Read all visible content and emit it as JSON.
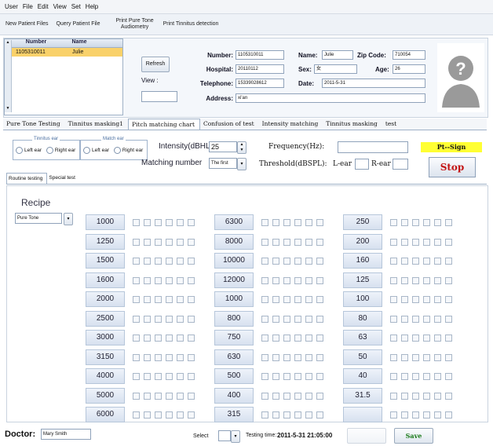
{
  "menu": [
    "User",
    "File",
    "Edit",
    "View",
    "Set",
    "Help"
  ],
  "toolbar": {
    "new_patient": "New Patient Files",
    "query_patient": "Query Patient File",
    "print_pure_tone_1": "Print Pure Tone",
    "print_pure_tone_2": "Audiometry",
    "print_tinnitus": "Print Tinnitus detection"
  },
  "patient_table": {
    "headers": [
      "Number",
      "Name"
    ],
    "rows": [
      {
        "number": "1105310011",
        "name": "Julie"
      }
    ]
  },
  "patient": {
    "refresh": "Refresh",
    "view_label": "View :",
    "number_label": "Number:",
    "number": "1105310011",
    "name_label": "Name:",
    "name": "Julie",
    "zip_label": "Zip Code:",
    "zip": "710054",
    "hospital_label": "Hospital:",
    "hospital": "20110112",
    "sex_label": "Sex:",
    "sex": "女",
    "age_label": "Age:",
    "age": "26",
    "telephone_label": "Telephone:",
    "telephone": "15339028612",
    "date_label": "Date:",
    "date": "2011-5-31",
    "address_label": "Address:",
    "address": "xi'an"
  },
  "tabs": [
    "Pure Tone Testing",
    "Tinnitus masking1",
    "Pitch matching chart",
    "Confusion of test",
    "Intensity matching",
    "Tinnitus masking",
    "test"
  ],
  "controls": {
    "tinnitus_ear_title": "Tinnitus ear",
    "match_ear_title": "Match ear",
    "left_ear": "Left ear",
    "right_ear": "Right ear",
    "intensity_label": "Intensity(dBHL)",
    "intensity_value": "25",
    "matching_label": "Matching number",
    "matching_value": "The first",
    "frequency_label": "Frequency(Hz):",
    "threshold_label": "Threshold(dBSPL):",
    "lear_label": "L-ear",
    "rear_label": "R-ear",
    "pt_sign": "Pt--Sign",
    "stop": "Stop"
  },
  "subtabs": [
    "Routine testing",
    "Special test"
  ],
  "recipe": {
    "label": "Recipe",
    "value": "Pure Tone"
  },
  "frequencies": {
    "col1": [
      "1000",
      "1250",
      "1500",
      "1600",
      "2000",
      "2500",
      "3000",
      "3150",
      "4000",
      "5000",
      "6000"
    ],
    "col2": [
      "6300",
      "8000",
      "10000",
      "12000",
      "1000",
      "800",
      "750",
      "630",
      "500",
      "400",
      "315"
    ],
    "col3": [
      "250",
      "200",
      "160",
      "125",
      "100",
      "80",
      "63",
      "50",
      "40",
      "31.5",
      ""
    ]
  },
  "footer": {
    "doctor_label": "Doctor:",
    "doctor": "Mary Smith",
    "select_label": "Select",
    "testing_time_label": "Testing time:",
    "testing_time": "2011-5-31 21:05:00",
    "save": "Save"
  },
  "colors": {
    "selected_row": "#f9d16a",
    "stop_text": "#c31414",
    "pt_sign_bg": "#ffff33"
  }
}
